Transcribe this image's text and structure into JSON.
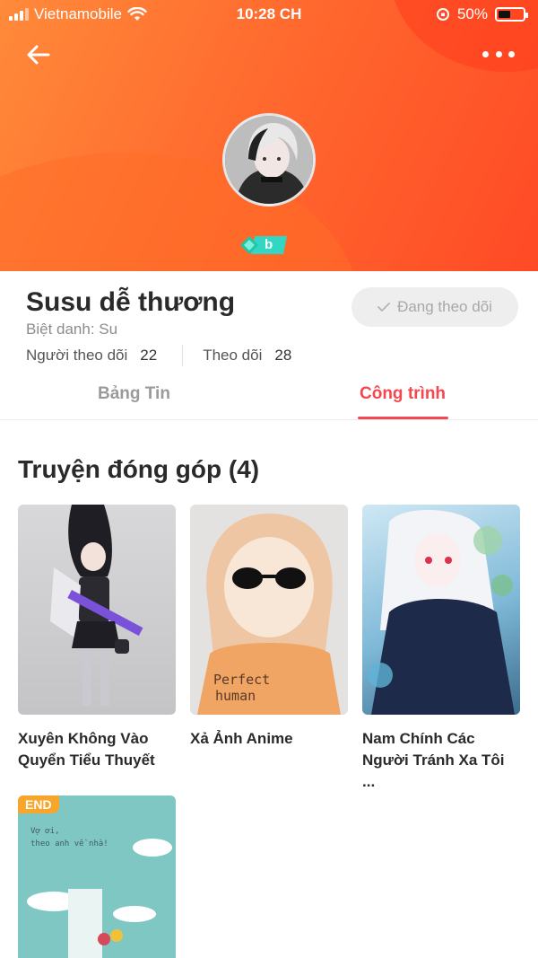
{
  "status_bar": {
    "carrier": "Vietnamobile",
    "time": "10:28 CH",
    "battery": "50%",
    "battery_level": 0.5
  },
  "profile": {
    "name": "Susu dễ thương",
    "nickname": "Biệt danh: Su",
    "followers_label": "Người theo dõi",
    "followers_count": "22",
    "following_label": "Theo dõi",
    "following_count": "28",
    "follow_button": "Đang theo dõi",
    "badge_letter": "b"
  },
  "tabs": {
    "feed": "Bảng Tin",
    "works": "Công trình",
    "active": "works"
  },
  "section": {
    "title": "Truyện đóng góp (4)"
  },
  "stories": [
    {
      "title_line1": "Xuyên Không Vào",
      "title_line2": "Quyển Tiểu Thuyết",
      "tag": ""
    },
    {
      "title_line1": "Xả Ảnh Anime",
      "title_line2": "",
      "tag": ""
    },
    {
      "title_line1": "Nam Chính Các",
      "title_line2": "Người Tránh Xa Tôi ...",
      "tag": ""
    },
    {
      "title_line1": "",
      "title_line2": "",
      "tag": "END",
      "cover_text1": "Vợ ơi,",
      "cover_text2": "theo anh về nhà!"
    }
  ],
  "cover4": {
    "cover_text1": "Vợ ơi,",
    "cover_text2": "theo anh về nhà!"
  },
  "colors": {
    "accent": "#f5474f",
    "header_gradient_start": "#ff8a3a",
    "header_gradient_end": "#ff4a26",
    "end_tag": "#f8a52c"
  },
  "icons": {
    "back": "back-arrow-icon",
    "more": "more-dots-icon",
    "wifi": "wifi-icon",
    "check": "check-icon",
    "badge": "diamond-badge-icon"
  }
}
